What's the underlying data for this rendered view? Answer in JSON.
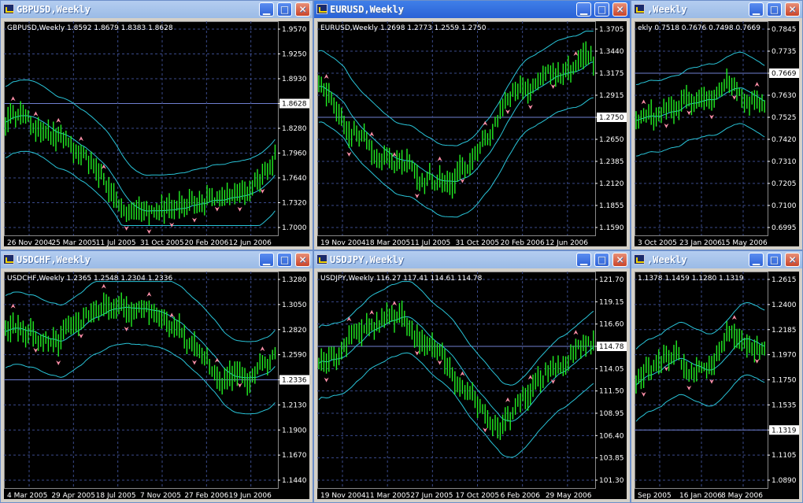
{
  "windows": [
    {
      "id": "gbpusd",
      "title": "GBPUSD,Weekly",
      "active": false,
      "info": "GBPUSD,Weekly  1.8592 1.8679 1.8383 1.8628",
      "prices": [
        "1.9570",
        "1.9250",
        "1.8930",
        "1.8628",
        "1.8280",
        "1.7960",
        "1.7640",
        "1.7320",
        "1.7000"
      ],
      "current": "1.8628",
      "dates": [
        "26 Nov 2004",
        "25 Mar 2005",
        "11 Jul 2005",
        "31 Oct 2005",
        "20 Feb 2006",
        "12 Jun 2006"
      ]
    },
    {
      "id": "eurusd",
      "title": "EURUSD,Weekly",
      "active": true,
      "info": "EURUSD,Weekly  1.2698 1.2773 1.2559 1.2750",
      "prices": [
        "1.3705",
        "1.3440",
        "1.3175",
        "1.2915",
        "1.2750",
        "1.2650",
        "1.2385",
        "1.2120",
        "1.1855",
        "1.1590"
      ],
      "current": "1.2750",
      "dates": [
        "19 Nov 2004",
        "18 Mar 2005",
        "11 Jul 2005",
        "31 Oct 2005",
        "20 Feb 2006",
        "12 Jun 2006"
      ]
    },
    {
      "id": "usdchf_partial",
      "title": ",Weekly",
      "active": false,
      "info": "ekly  0.7518 0.7676 0.7498 0.7669",
      "prices": [
        "0.7845",
        "0.7735",
        "0.7669",
        "0.7630",
        "0.7525",
        "0.7420",
        "0.7310",
        "0.7205",
        "0.7100",
        "0.6995"
      ],
      "current": "0.7669",
      "dates": [
        "3 Oct 2005",
        "23 Jan 2006",
        "15 May 2006"
      ]
    },
    {
      "id": "usdchf",
      "title": "USDCHF,Weekly",
      "active": false,
      "info": "USDCHF,Weekly  1.2365 1.2548 1.2304 1.2336",
      "prices": [
        "1.3280",
        "1.3050",
        "1.2820",
        "1.2590",
        "1.2336",
        "1.2130",
        "1.1900",
        "1.1670",
        "1.1440"
      ],
      "current": "1.2336",
      "dates": [
        "4 Mar 2005",
        "29 Apr 2005",
        "18 Jul 2005",
        "7 Nov 2005",
        "27 Feb 2006",
        "19 Jun 2006"
      ]
    },
    {
      "id": "usdjpy",
      "title": "USDJPY,Weekly",
      "active": false,
      "info": "USDJPY,Weekly  116.27 117.41 114.61 114.78",
      "prices": [
        "121.70",
        "119.15",
        "116.60",
        "114.78",
        "114.05",
        "111.50",
        "108.95",
        "106.40",
        "103.85",
        "101.30"
      ],
      "current": "114.78",
      "dates": [
        "19 Nov 2004",
        "11 Mar 2005",
        "27 Jun 2005",
        "17 Oct 2005",
        "6 Feb 2006",
        "29 May 2006"
      ]
    },
    {
      "id": "partial4",
      "title": ",Weekly",
      "active": false,
      "info": "  1.1378 1.1459 1.1280 1.1319",
      "prices": [
        "1.2615",
        "1.2400",
        "1.2185",
        "1.1970",
        "1.1750",
        "1.1535",
        "1.1319",
        "1.1105",
        "1.0890"
      ],
      "current": "1.1319",
      "dates": [
        "Sep 2005",
        "16 Jan 2006",
        "8 May 2006"
      ]
    }
  ],
  "buttons": {
    "minimize": "▁",
    "maximize": "□",
    "close": "✕"
  },
  "colors": {
    "candle": "#22ee22",
    "band": "#29c4d8",
    "ma": "#29c4d8",
    "fractal": "#ff8fa8",
    "grid": "#3a4a8a",
    "axis_text": "#ffffff",
    "label_bg": "#ffffff"
  }
}
